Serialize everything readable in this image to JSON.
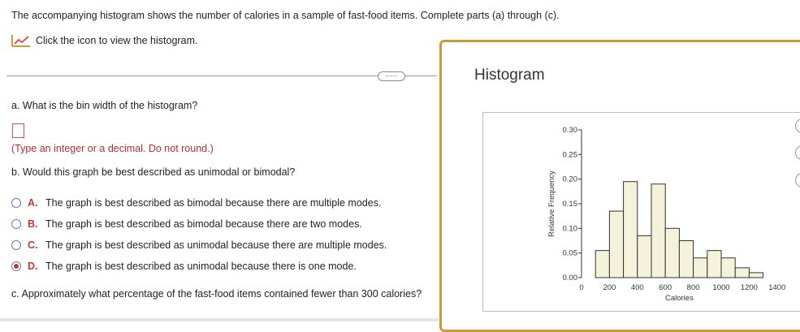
{
  "prompt": "The accompanying histogram shows the number of calories in a sample of fast-food items. Complete parts (a) through (c).",
  "icon_link": {
    "icon": "chart-line-icon",
    "label": "Click the icon to view the histogram."
  },
  "more_button": "·····",
  "part_a": {
    "question": "a. What is the bin width of the histogram?",
    "hint": "(Type an integer or a decimal. Do not round.)"
  },
  "part_b": {
    "question": "b. Would this graph be best described as unimodal or bimodal?",
    "options": [
      {
        "letter": "A.",
        "text": "The graph is best described as bimodal because there are multiple modes.",
        "selected": false
      },
      {
        "letter": "B.",
        "text": "The graph is best described as bimodal because there are two modes.",
        "selected": false
      },
      {
        "letter": "C.",
        "text": "The graph is best described as unimodal because there are multiple modes.",
        "selected": false
      },
      {
        "letter": "D.",
        "text": "The graph is best described as unimodal because there is one mode.",
        "selected": true
      }
    ]
  },
  "part_c": {
    "question": "c. Approximately what percentage of the fast-food items contained fewer than 300 calories?"
  },
  "panel": {
    "title": "Histogram"
  },
  "chart_data": {
    "type": "bar",
    "title": "",
    "xlabel": "Calories",
    "ylabel": "Relative Frequency",
    "x_ticks": [
      "0",
      "200",
      "400",
      "600",
      "800",
      "1000",
      "1200",
      "1400"
    ],
    "y_ticks": [
      "0.00",
      "0.05",
      "0.10",
      "0.15",
      "0.20",
      "0.25",
      "0.30"
    ],
    "ylim": [
      0,
      0.3
    ],
    "bin_width": 100,
    "bins": [
      {
        "start": 100,
        "end": 200,
        "value": 0.055
      },
      {
        "start": 200,
        "end": 300,
        "value": 0.135
      },
      {
        "start": 300,
        "end": 400,
        "value": 0.195
      },
      {
        "start": 400,
        "end": 500,
        "value": 0.085
      },
      {
        "start": 500,
        "end": 600,
        "value": 0.19
      },
      {
        "start": 600,
        "end": 700,
        "value": 0.1
      },
      {
        "start": 700,
        "end": 800,
        "value": 0.075
      },
      {
        "start": 800,
        "end": 900,
        "value": 0.04
      },
      {
        "start": 900,
        "end": 1000,
        "value": 0.055
      },
      {
        "start": 1000,
        "end": 1100,
        "value": 0.04
      },
      {
        "start": 1100,
        "end": 1200,
        "value": 0.02
      },
      {
        "start": 1200,
        "end": 1300,
        "value": 0.01
      }
    ],
    "bar_fill": "#f5f2dc",
    "bar_stroke": "#333333"
  }
}
